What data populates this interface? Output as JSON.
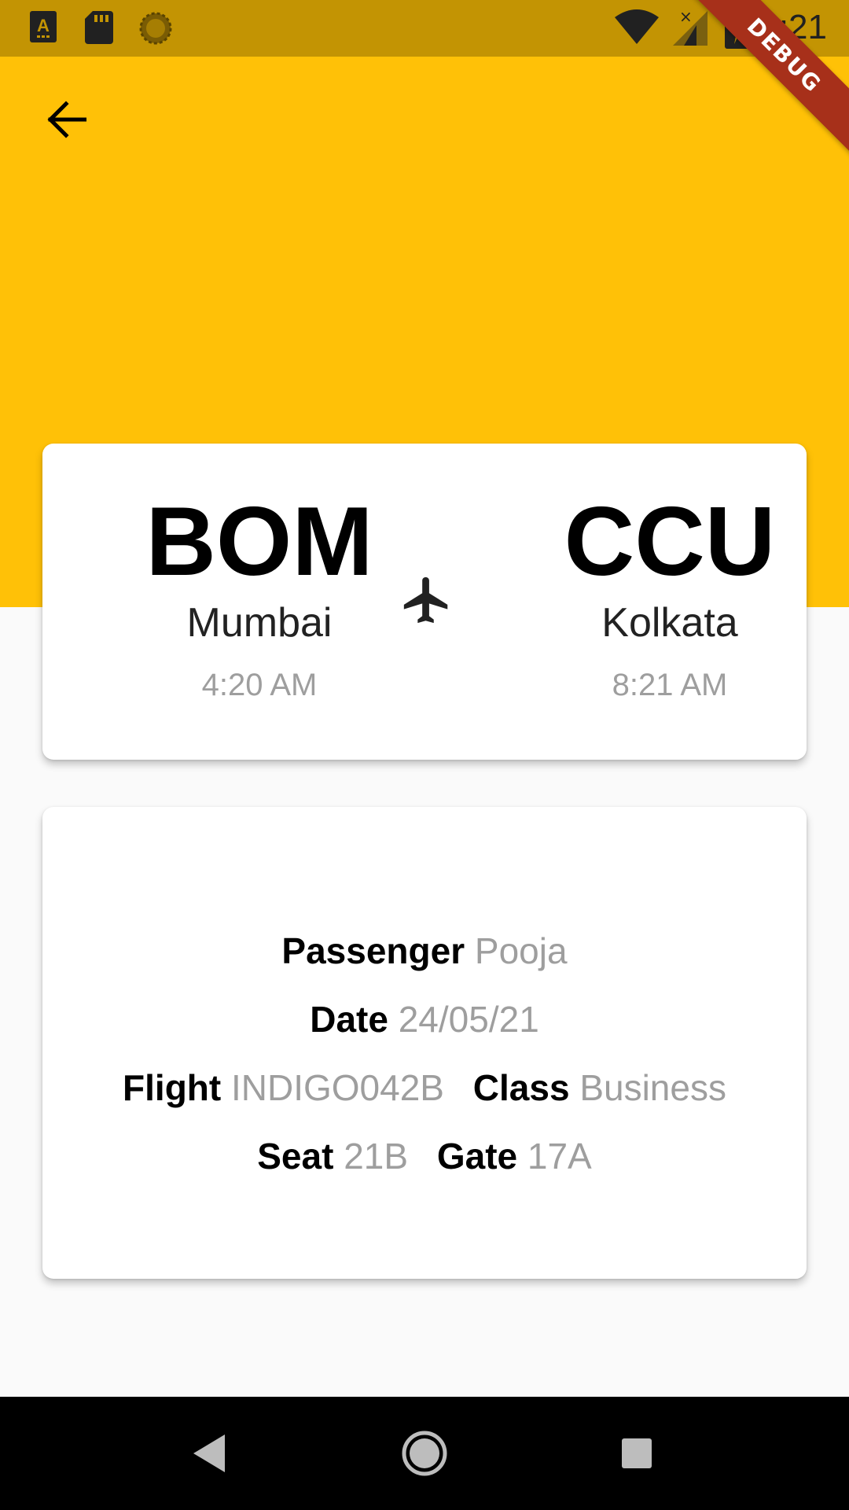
{
  "status_bar": {
    "time": "2:21",
    "icons": [
      "a-notification-icon",
      "sd-card-icon",
      "sync-icon",
      "wifi-icon",
      "signal-icon",
      "battery-charging-icon"
    ]
  },
  "ribbon": {
    "label": "DEBUG"
  },
  "header": {
    "back_icon": "arrow-back-icon",
    "color": "#ffc107"
  },
  "route": {
    "from": {
      "code": "BOM",
      "city": "Mumbai",
      "time": "4:20 AM"
    },
    "to": {
      "code": "CCU",
      "city": "Kolkata",
      "time": "8:21 AM"
    },
    "plane_icon": "airplane-icon"
  },
  "details": {
    "passenger": {
      "label": "Passenger",
      "value": "Pooja"
    },
    "date": {
      "label": "Date",
      "value": "24/05/21"
    },
    "flight": {
      "label": "Flight",
      "value": "INDIGO042B"
    },
    "class": {
      "label": "Class",
      "value": "Business"
    },
    "seat": {
      "label": "Seat",
      "value": "21B"
    },
    "gate": {
      "label": "Gate",
      "value": "17A"
    }
  },
  "nav": {
    "icons": [
      "back-triangle-icon",
      "home-circle-icon",
      "recents-square-icon"
    ]
  }
}
